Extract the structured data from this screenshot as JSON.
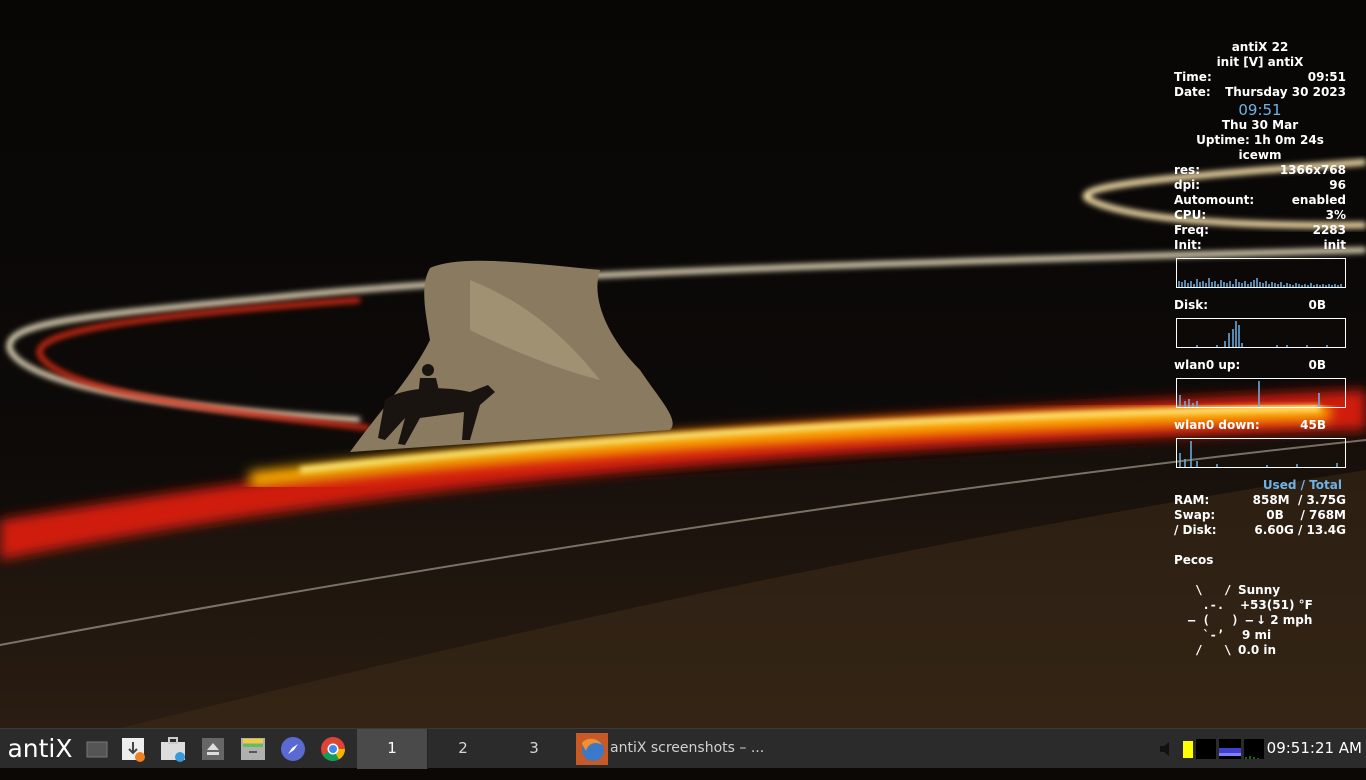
{
  "desktop": {
    "conky": {
      "os": "antiX 22",
      "init_line": "init [V] antiX",
      "time_label": "Time:",
      "time_value": "09:51",
      "date_label": "Date:",
      "date_value": "Thursday 30 2023",
      "big_time": "09:51",
      "short_date": "Thu 30 Mar",
      "uptime": "Uptime: 1h 0m 24s",
      "wm": "icewm",
      "res_label": "res:",
      "res_value": "1366x768",
      "dpi_label": "dpi:",
      "dpi_value": "96",
      "automount_label": "Automount:",
      "automount_value": "enabled",
      "cpu_label": "CPU:",
      "cpu_value": "3%",
      "freq_label": "Freq:",
      "freq_value": "2283",
      "init_label": "Init:",
      "init_value": "init",
      "disk_label": "Disk:",
      "disk_value": "0B",
      "wlan_up_label": "wlan0 up:",
      "wlan_up_value": "0B",
      "wlan_down_label": "wlan0 down:",
      "wlan_down_value": "45B",
      "used_header": "Used",
      "slash": "/",
      "total_header": "Total",
      "ram_label": "RAM:",
      "ram_value": "858M  / 3.75G",
      "swap_label": "Swap:",
      "swap_value": "0B    / 768M",
      "rootdisk_label": "/ Disk:",
      "rootdisk_value": "6.60G / 13.4G",
      "weather_location": "Pecos",
      "weather": [
        {
          "art": " \\   /  ",
          "text": "Sunny"
        },
        {
          "art": "  .-.   ",
          "text": "+53(51) °F"
        },
        {
          "art": "― (   ) ―",
          "text": "↓ 2 mph"
        },
        {
          "art": "  `-’   ",
          "text": "9 mi"
        },
        {
          "art": " /   \\  ",
          "text": "0.0 in"
        }
      ]
    }
  },
  "taskbar": {
    "start_label": "antiX",
    "quicklaunch": [
      "show-desktop-icon",
      "download-icon",
      "package-installer-icon",
      "eject-icon",
      "file-manager-icon",
      "browser-compass-icon",
      "chrome-icon"
    ],
    "desktops": [
      "1",
      "2",
      "3"
    ],
    "active_desktop": "1",
    "task_title": "antiX screenshots – ...",
    "clock": "09:51:21 AM"
  },
  "colors": {
    "conky_accent": "#6fb3e6",
    "taskbar_bg": "#2b2b2b",
    "active_desktop_bg": "#4a4a4a"
  }
}
